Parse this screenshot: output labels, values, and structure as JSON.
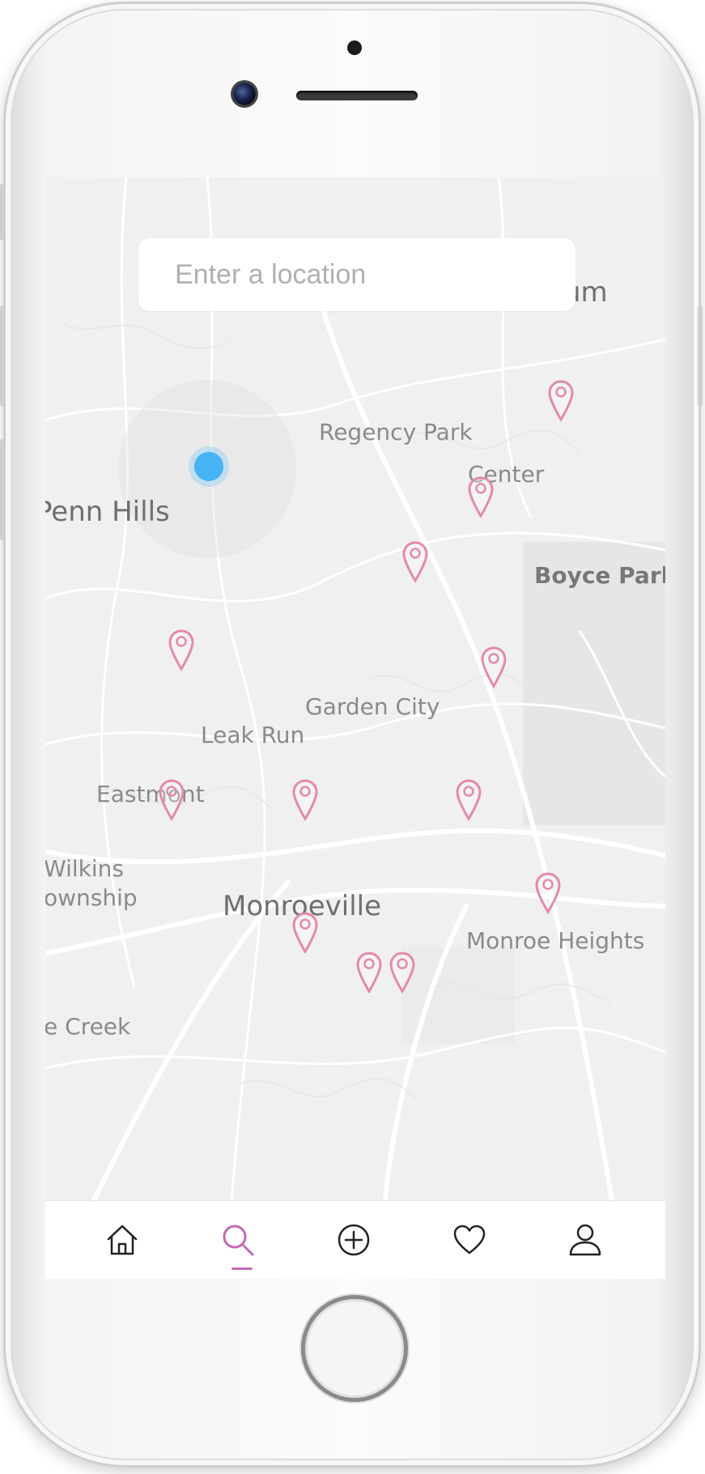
{
  "search": {
    "placeholder": "Enter a location"
  },
  "map": {
    "places": [
      {
        "label": "Plum"
      },
      {
        "label": "Regency Park"
      },
      {
        "label": "Center"
      },
      {
        "label": "Penn Hills"
      },
      {
        "label": "Boyce Park"
      },
      {
        "label": "Garden City"
      },
      {
        "label": "Leak Run"
      },
      {
        "label": "Eastmont"
      },
      {
        "label": "Wilkins"
      },
      {
        "label": "ownship"
      },
      {
        "label": "Monroeville"
      },
      {
        "label": "Monroe Heights"
      },
      {
        "label": "e Creek"
      }
    ]
  },
  "tabbar": {
    "items": [
      {
        "icon": "home-icon"
      },
      {
        "icon": "search-icon"
      },
      {
        "icon": "add-icon"
      },
      {
        "icon": "heart-icon"
      },
      {
        "icon": "profile-icon"
      }
    ],
    "active_index": 1
  },
  "colors": {
    "pin": "#e48aa6",
    "active_tab": "#c36ab3",
    "user_location": "#46b3f5",
    "map_background": "#f1f1f1"
  }
}
